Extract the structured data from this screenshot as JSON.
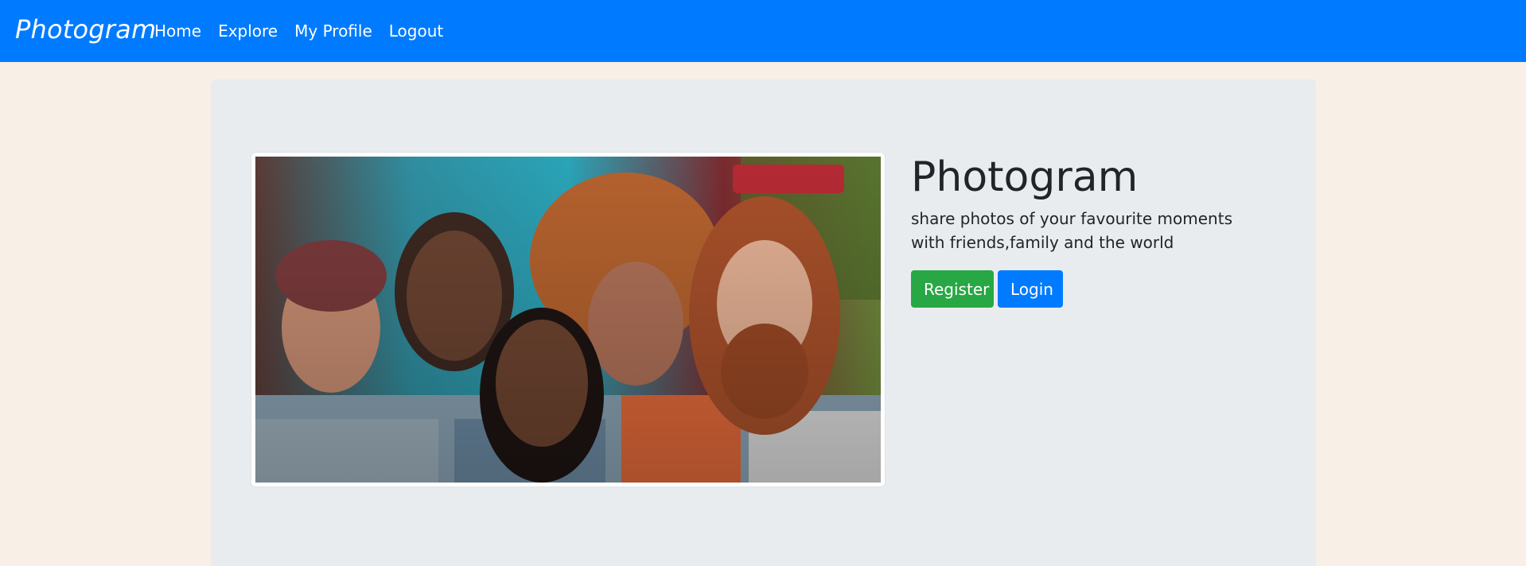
{
  "navbar": {
    "brand": "Photogram",
    "links": [
      "Home",
      "Explore",
      "My Profile",
      "Logout"
    ],
    "background_color": "#007bff"
  },
  "hero": {
    "title": "Photogram",
    "lead": "share photos of your favourite moments with friends,family and the world",
    "register_label": "Register",
    "login_label": "Login",
    "register_color": "#28a745",
    "login_color": "#007bff"
  }
}
